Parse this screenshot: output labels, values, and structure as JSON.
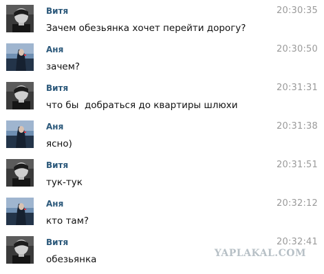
{
  "messages": [
    {
      "author": "Витя",
      "time": "20:30:35",
      "text": "Зачем обезьянка хочет перейти дорогу?",
      "avatar": "vitya"
    },
    {
      "author": "Аня",
      "time": "20:30:50",
      "text": "зачем?",
      "avatar": "anya"
    },
    {
      "author": "Витя",
      "time": "20:31:31",
      "text": "что бы  добраться до квартиры шлюхи",
      "avatar": "vitya"
    },
    {
      "author": "Аня",
      "time": "20:31:38",
      "text": "ясно)",
      "avatar": "anya"
    },
    {
      "author": "Витя",
      "time": "20:31:51",
      "text": "тук-тук",
      "avatar": "vitya"
    },
    {
      "author": "Аня",
      "time": "20:32:12",
      "text": "кто там?",
      "avatar": "anya"
    },
    {
      "author": "Витя",
      "time": "20:32:41",
      "text": "обезьянка",
      "avatar": "vitya"
    }
  ],
  "watermark": "YAPLAKAL.COM",
  "colors": {
    "author": "#2b587a",
    "time": "#9a9a9a",
    "text": "#111111",
    "watermark": "#b7c0c6"
  }
}
